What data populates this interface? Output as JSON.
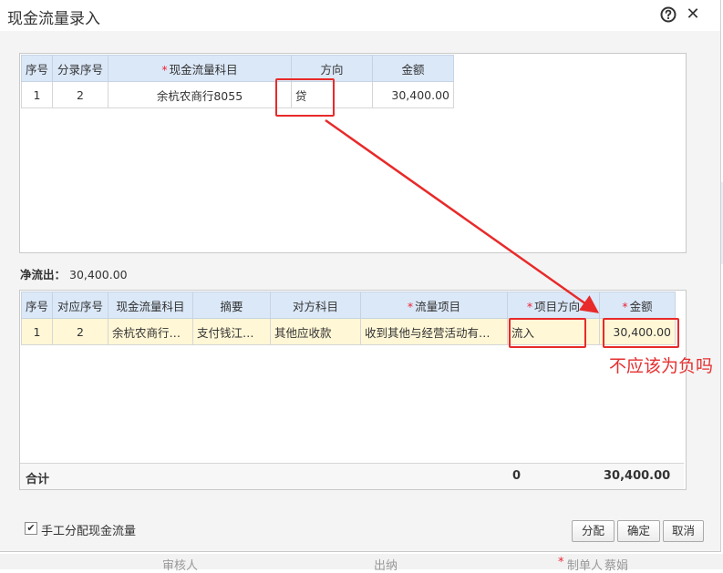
{
  "dialog": {
    "title": "现金流量录入"
  },
  "top_table": {
    "headers": [
      "序号",
      "分录序号",
      "现金流量科目",
      "方向",
      "金额"
    ],
    "required_marks": [
      "*"
    ],
    "rows": [
      {
        "seq": "1",
        "entry_seq": "2",
        "account": "余杭农商行8055",
        "direction": "贷",
        "amount": "30,400.00"
      }
    ]
  },
  "net_outflow": {
    "label": "净流出：",
    "value": "30,400.00"
  },
  "bottom_table": {
    "headers": [
      "序号",
      "对应序号",
      "现金流量科目",
      "摘要",
      "对方科目",
      "流量项目",
      "项目方向",
      "金额"
    ],
    "required_mark": "*",
    "rows": [
      {
        "seq": "1",
        "corr_seq": "2",
        "account": "余杭农商行…",
        "summary": "支付钱江…",
        "counter_account": "其他应收款",
        "flow_item": "收到其他与经营活动有…",
        "item_direction": "流入",
        "amount": "30,400.00"
      }
    ],
    "total": {
      "label": "合计",
      "zero": "0",
      "amount": "30,400.00"
    }
  },
  "footer": {
    "manual_checkbox_label": "手工分配现金流量",
    "manual_checked": true,
    "check_mark": "✔",
    "buttons": {
      "distribute": "分配",
      "ok": "确定",
      "cancel": "取消"
    }
  },
  "underlying_page": {
    "texts": [
      "审核人",
      "出纳",
      "*",
      "制单人",
      "蔡娟"
    ]
  },
  "annotation": {
    "text": "不应该为负吗",
    "color": "#e53030"
  },
  "icons": {
    "help": "help-circle-icon",
    "close": "close-icon"
  },
  "colors": {
    "header_bg": "#dbe8f8",
    "selected_row_bg": "#fff7d6",
    "annotation_red": "#e82a2a"
  }
}
